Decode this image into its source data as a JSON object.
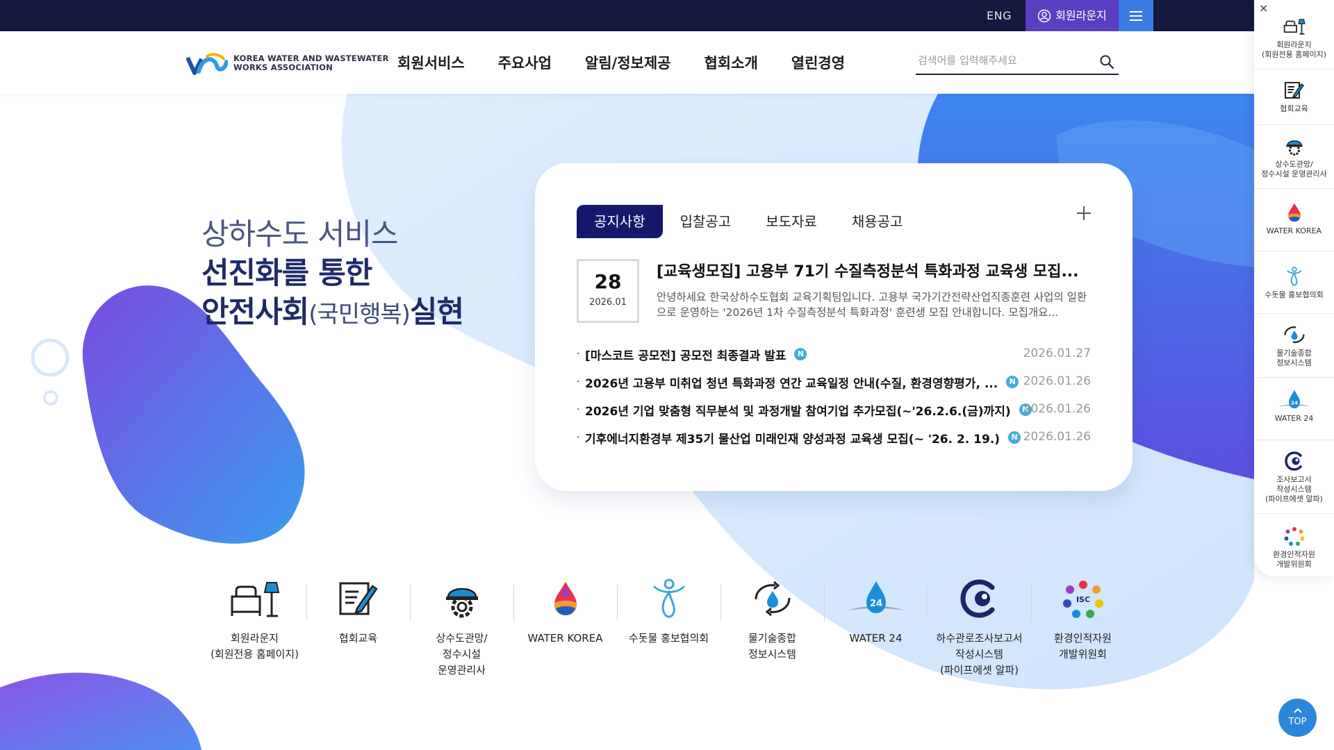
{
  "topbar": {
    "lang_label": "ENG",
    "member_lounge_label": "회원라운지",
    "menu_icon": "hamburger-icon"
  },
  "header": {
    "logo_line1": "KOREA WATER AND WASTEWATER",
    "logo_line2": "WORKS ASSOCIATION",
    "nav": [
      "회원서비스",
      "주요사업",
      "알림/정보제공",
      "협회소개",
      "열린경영"
    ],
    "search_placeholder": "검색어를 입력해주세요",
    "search_icon": "search-icon"
  },
  "hero": {
    "line1": "상하수도 서비스",
    "line2": "선진화를 통한",
    "line3_a": "안전사회",
    "line3_b": "(국민행복)",
    "line3_c": "실현"
  },
  "notice": {
    "tabs": [
      "공지사항",
      "입찰공고",
      "보도자료",
      "채용공고"
    ],
    "active_tab": "공지사항",
    "featured": {
      "day": "28",
      "month": "2026.01",
      "title": "[교육생모집] 고용부 71기 수질측정분석 특화과정 교육생 모집...",
      "desc": "안녕하세요 한국상하수도협회 교육기획팀입니다. 고용부 국가기간전략산업직종훈련 사업의 일환으로 운영하는 '2026년 1차 수질측정분석 특화과정' 훈련생 모집 안내합니다. 모집개요..."
    },
    "items": [
      {
        "title": "[마스코트 공모전] 공모전 최종결과 발표",
        "badge": "N",
        "date": "2026.01.27"
      },
      {
        "title": "2026년 고용부 미취업 청년 특화과정 연간 교육일정 안내(수질, 환경영향평가, ...",
        "badge": "N",
        "date": "2026.01.26"
      },
      {
        "title": "2026년 기업 맞춤형 직무분석 및 과정개발 참여기업 추가모집(~'26.2.6.(금)까지)",
        "badge": "N",
        "date": "2026.01.26"
      },
      {
        "title": "기후에너지환경부 제35기 물산업 미래인재 양성과정 교육생 모집(~ '26. 2. 19.)",
        "badge": "N",
        "date": "2026.01.26"
      }
    ]
  },
  "quick_links": [
    {
      "label1": "회원라운지",
      "label2": "(회원전용 홈페이지)",
      "label3": "",
      "icon": "sofa-lamp-icon"
    },
    {
      "label1": "협회교육",
      "label2": "",
      "label3": "",
      "icon": "notepad-pencil-icon"
    },
    {
      "label1": "상수도관망/",
      "label2": "정수시설",
      "label3": "운영관리사",
      "icon": "helmet-gear-icon"
    },
    {
      "label1": "WATER KOREA",
      "label2": "",
      "label3": "",
      "icon": "water-drop-flame-icon"
    },
    {
      "label1": "수돗물 홍보협의회",
      "label2": "",
      "label3": "",
      "icon": "water-person-icon"
    },
    {
      "label1": "물기술종합",
      "label2": "정보시스템",
      "label3": "",
      "icon": "recycle-drop-icon"
    },
    {
      "label1": "WATER 24",
      "label2": "",
      "label3": "",
      "icon": "water-24-icon"
    },
    {
      "label1": "하수관로조사보고서",
      "label2": "작성시스템",
      "label3": "(파이프에셋 알파)",
      "icon": "pipe-eye-icon"
    },
    {
      "label1": "환경인적자원",
      "label2": "개발위원회",
      "label3": "",
      "icon": "isc-logo-icon"
    }
  ],
  "side_panel": {
    "close_label": "×",
    "items": [
      {
        "label1": "회원라운지",
        "label2": "(회원전용 홈페이지)",
        "label3": ""
      },
      {
        "label1": "협회교육",
        "label2": "",
        "label3": ""
      },
      {
        "label1": "상수도관망/",
        "label2": "정수시설 운영관리사",
        "label3": ""
      },
      {
        "label1": "WATER KOREA",
        "label2": "",
        "label3": ""
      },
      {
        "label1": "수돗물 홍보협의회",
        "label2": "",
        "label3": ""
      },
      {
        "label1": "물기술종합",
        "label2": "정보시스템",
        "label3": ""
      },
      {
        "label1": "WATER 24",
        "label2": "",
        "label3": ""
      },
      {
        "label1": "조사보고서",
        "label2": "작성시스템",
        "label3": "(파이프에셋 알파)"
      },
      {
        "label1": "환경인적자원",
        "label2": "개발위원회",
        "label3": ""
      }
    ]
  },
  "top_button": {
    "label": "TOP"
  },
  "colors": {
    "topbar_bg": "#15193d",
    "lounge_bg": "#5b3fc0",
    "menu_bg": "#3a7ce3",
    "tab_active": "#15186d",
    "new_badge": "#3faed9",
    "top_button": "#2d87d9"
  }
}
